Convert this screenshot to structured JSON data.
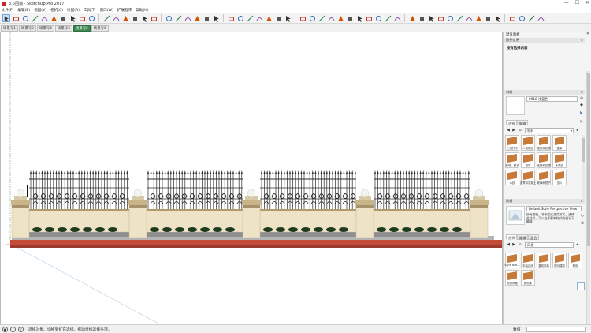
{
  "window": {
    "title": "3.6围墙 - SketchUp Pro 2017",
    "controls": [
      "—",
      "☐",
      "✕"
    ]
  },
  "menu": [
    "文件(F)",
    "编辑(E)",
    "视图(V)",
    "相机(C)",
    "绘图(R)",
    "工具(T)",
    "窗口(W)",
    "扩展程序",
    "帮助(H)"
  ],
  "scene_tabs": [
    {
      "label": "场景号1",
      "active": false
    },
    {
      "label": "场景号2",
      "active": false
    },
    {
      "label": "场景号4",
      "active": false
    },
    {
      "label": "场景号3",
      "active": false
    },
    {
      "label": "场景号5",
      "active": true
    },
    {
      "label": "场景号6",
      "active": false
    }
  ],
  "toolbar_icons": [
    "select-icon",
    "eraser-icon",
    "pencil-icon",
    "line-dropdown-icon",
    "arc-icon",
    "arc-dropdown-icon",
    "shape-icon",
    "shape-dropdown-icon",
    "push-pull-icon",
    "move-icon",
    "rotate-icon",
    "scale-icon",
    "offset-icon",
    "tape-measure-icon",
    "text-icon",
    "axes-icon",
    "paint-bucket-icon",
    "orbit-icon",
    "pan-icon",
    "zoom-icon",
    "zoom-extents-icon",
    "section-plane-icon",
    "warehouse-icon",
    "components-icon",
    "materials-icon",
    "styles-icon",
    "extension-icon",
    "solid-tools-icon",
    "sandbox-icon",
    "follow-me-icon",
    "intersect-icon",
    "outer-shell-icon",
    "union-icon",
    "subtract-icon",
    "trim-icon",
    "split-icon",
    "curve-icon",
    "arc-tool-icon",
    "bezier-icon",
    "spline-icon",
    "ruler-icon",
    "dim-icon",
    "protractor-icon",
    "label-icon",
    "layer-icon",
    "tag-icon",
    "camera-icon",
    "walk-icon",
    "look-icon",
    "position-camera-icon",
    "section-fill-icon",
    "export-icon",
    "render-icon",
    "su-icon"
  ],
  "status": {
    "text": "选择对象。切换到扩充选择。拖动鼠标选择多项。",
    "measure_label": "数值"
  },
  "panels": {
    "default_tray": "默认面板",
    "entity_info": {
      "header": "图元信息",
      "value": "没有选择内容"
    },
    "materials": {
      "header": "材料",
      "current": "0018 浅蓝色",
      "tabs": [
        "选择",
        "编辑"
      ],
      "collection": "材料",
      "items": [
        "三维打印",
        "人造表面",
        "图案和纹理",
        "图案",
        "玻璃、镜子",
        "窗帘",
        "地毯和纹理",
        "木质纹",
        "水纹",
        "沥青和混凝土",
        "玻璃和镜子",
        "瓦片"
      ]
    },
    "styles": {
      "header": "风格",
      "name": "Default Style Perspective View",
      "description": "所有透视，非照相式渲染方式。选择此样式，可以在不影响样式的情况下编辑",
      "tabs": [
        "选择",
        "编辑",
        "混合"
      ],
      "collection": "风格",
      "items": [
        "Style Buil...",
        "手绘边线",
        "直线风格",
        "照片建模",
        "颜色",
        "预设风格",
        "颜色集"
      ]
    }
  },
  "colors": {
    "accent_tab": "#3c8a52",
    "material_swatch": "#c77b3a",
    "brick": "#c44a3a",
    "pillar": "#efe3c7",
    "fence_iron": "#2b2b2b",
    "stone": "#8e8e8e"
  }
}
